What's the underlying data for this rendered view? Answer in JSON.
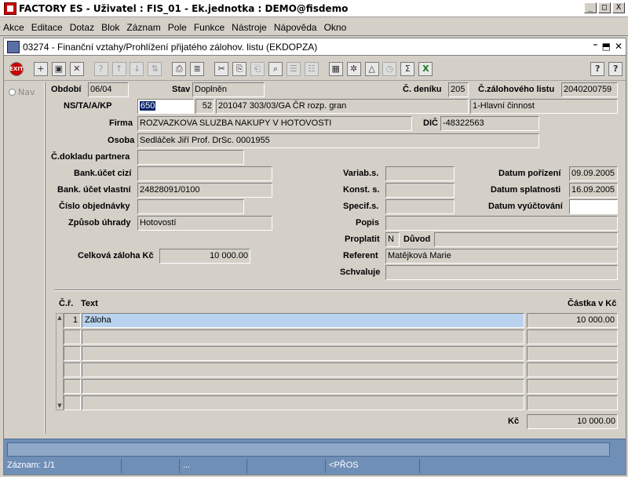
{
  "app": {
    "title": "FACTORY ES - Uživatel : FIS_01 - Ek.jednotka : DEMO@fisdemo",
    "window_buttons": [
      "_",
      "□",
      "X"
    ]
  },
  "menu": [
    "Akce",
    "Editace",
    "Dotaz",
    "Blok",
    "Záznam",
    "Pole",
    "Funkce",
    "Nástroje",
    "Nápověda",
    "Okno"
  ],
  "form": {
    "title": "03274 - Finanční vztahy/Prohlížení přijatého zálohov. listu (EKDOPZA)",
    "controls": [
      "⁼",
      "⬒",
      "✕"
    ]
  },
  "toolbar": [
    {
      "icon": "exit-icon",
      "glyph": "EXIT"
    },
    {
      "icon": "insert-record-icon",
      "glyph": "+"
    },
    {
      "icon": "save-record-icon",
      "glyph": "▣"
    },
    {
      "icon": "delete-record-icon",
      "glyph": "✕"
    },
    {
      "icon": "query-icon",
      "glyph": "?"
    },
    {
      "icon": "sort-asc-icon",
      "glyph": "↑"
    },
    {
      "icon": "sort-desc-icon",
      "glyph": "↓"
    },
    {
      "icon": "sort-icon",
      "glyph": "⇅"
    },
    {
      "icon": "print-icon",
      "glyph": "⎙"
    },
    {
      "icon": "report-icon",
      "glyph": "≣"
    },
    {
      "icon": "cut-icon",
      "glyph": "✂"
    },
    {
      "icon": "copy-icon",
      "glyph": "⎘"
    },
    {
      "icon": "paste-icon",
      "glyph": "⎗"
    },
    {
      "icon": "find-icon",
      "glyph": "⌕"
    },
    {
      "icon": "list-icon",
      "glyph": "☰"
    },
    {
      "icon": "list2-icon",
      "glyph": "☷"
    },
    {
      "icon": "calculator-icon",
      "glyph": "▦"
    },
    {
      "icon": "wheel-icon",
      "glyph": "✲"
    },
    {
      "icon": "triangle-icon",
      "glyph": "△"
    },
    {
      "icon": "clock-icon",
      "glyph": "◷"
    },
    {
      "icon": "sum-icon",
      "glyph": "Σ"
    },
    {
      "icon": "excel-icon",
      "glyph": "X"
    },
    {
      "icon": "help-icon",
      "glyph": "?"
    },
    {
      "icon": "context-help-icon",
      "glyph": "?"
    }
  ],
  "nav": {
    "label": "Nav"
  },
  "labels": {
    "obdobi": "Období",
    "stav": "Stav",
    "c_deniku": "Č. deníku",
    "c_zalohoveho_listu": "Č.zálohového listu",
    "ns": "NS/TA/A/KP",
    "firma": "Firma",
    "dic": "DIČ",
    "osoba": "Osoba",
    "c_dokladu_partnera": "Č.dokladu partnera",
    "bank_ucet_cizi": "Bank.účet cizí",
    "bank_ucet_vlastni": "Bank. účet vlastní",
    "cislo_objednavky": "Číslo objednávky",
    "zpusob_uhrady": "Způsob úhrady",
    "variab_s": "Variab.s.",
    "konst_s": "Konst. s.",
    "specif_s": "Specif.s.",
    "popis": "Popis",
    "proplatit": "Proplatit",
    "duvod": "Důvod",
    "referent": "Referent",
    "schvaluje": "Schvaluje",
    "datum_porizeni": "Datum pořízení",
    "datum_splatnosti": "Datum splatnosti",
    "datum_vyuctovani": "Datum vyúčtování",
    "celkova_zaloha": "Celková záloha Kč"
  },
  "values": {
    "obdobi": "06/04",
    "stav": "Doplněn",
    "c_deniku": "205",
    "c_zalohoveho_listu": "2040200759",
    "ns": "650",
    "ns_ta": "52",
    "ns_a": "201047 303/03/GA ČR rozp. gran",
    "ns_kp": "1-Hlavní činnost",
    "firma": "ROZVAZKOVA SLUZBA NAKUPY V HOTOVOSTI",
    "dic": "-48322563",
    "osoba": "Sedláček Jiří Prof. DrSc. 0001955",
    "c_dokladu_partnera": "",
    "bank_ucet_cizi": "",
    "bank_ucet_vlastni": "24828091/0100",
    "cislo_objednavky": "",
    "zpusob_uhrady": "Hotovostí",
    "variab_s": "",
    "konst_s": "",
    "specif_s": "",
    "popis": "",
    "proplatit": "N",
    "duvod": "",
    "referent": "Matějková Marie",
    "schvaluje": "",
    "datum_porizeni": "09.09.2005",
    "datum_splatnosti": "16.09.2005",
    "datum_vyuctovani": "",
    "celkova_zaloha": "10 000.00"
  },
  "table": {
    "headers": {
      "cr": "Č.ř.",
      "text": "Text",
      "castka": "Částka v Kč"
    },
    "rows": [
      {
        "cr": "1",
        "text": "Záloha",
        "castka": "10 000.00"
      },
      {
        "cr": "",
        "text": "",
        "castka": ""
      },
      {
        "cr": "",
        "text": "",
        "castka": ""
      },
      {
        "cr": "",
        "text": "",
        "castka": ""
      },
      {
        "cr": "",
        "text": "",
        "castka": ""
      },
      {
        "cr": "",
        "text": "",
        "castka": ""
      }
    ],
    "total_label": "Kč",
    "total_value": "10 000.00"
  },
  "status": {
    "record": "Záznam: 1/1",
    "s2": "",
    "s3": "...",
    "s4": "",
    "s5": "<PŘOS"
  }
}
